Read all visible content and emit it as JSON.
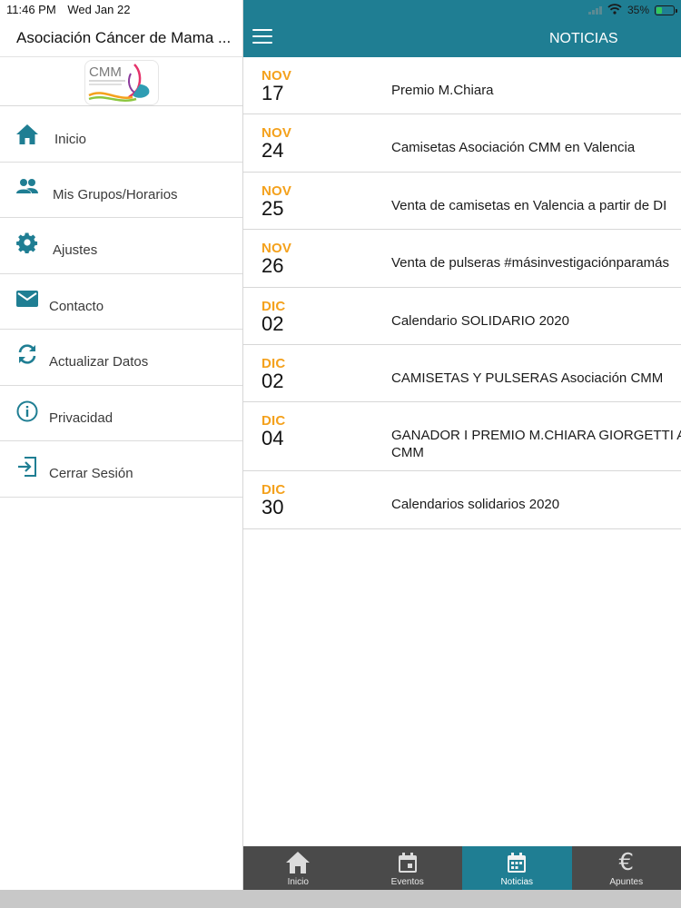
{
  "status_bar": {
    "time": "11:46 PM",
    "date": "Wed Jan 22",
    "battery_text": "35%",
    "battery_level": 0.35
  },
  "sidebar": {
    "app_title": "Asociación Cáncer de Mama ...",
    "logo_text": "CMM",
    "items": [
      {
        "label": "Inicio",
        "icon": "home-icon"
      },
      {
        "label": "Mis Grupos/Horarios",
        "icon": "people-icon"
      },
      {
        "label": "Ajustes",
        "icon": "gear-icon"
      },
      {
        "label": "Contacto",
        "icon": "mail-icon"
      },
      {
        "label": "Actualizar Datos",
        "icon": "refresh-icon"
      },
      {
        "label": "Privacidad",
        "icon": "info-icon"
      },
      {
        "label": "Cerrar Sesión",
        "icon": "logout-icon"
      }
    ]
  },
  "header": {
    "title": "NOTICIAS"
  },
  "news": [
    {
      "month": "NOV",
      "day": "17",
      "title": "Premio M.Chiara"
    },
    {
      "month": "NOV",
      "day": "24",
      "title": "Camisetas Asociación CMM en Valencia"
    },
    {
      "month": "NOV",
      "day": "25",
      "title": "Venta de camisetas en Valencia a partir de DI"
    },
    {
      "month": "NOV",
      "day": "26",
      "title": "Venta de pulseras #másinvestigaciónparamás"
    },
    {
      "month": "DIC",
      "day": "02",
      "title": "Calendario SOLIDARIO 2020"
    },
    {
      "month": "DIC",
      "day": "02",
      "title": "CAMISETAS Y PULSERAS Asociación CMM"
    },
    {
      "month": "DIC",
      "day": "04",
      "title": "GANADOR I PREMIO M.CHIARA GIORGETTI A CMM"
    },
    {
      "month": "DIC",
      "day": "30",
      "title": "Calendarios solidarios 2020"
    }
  ],
  "tabs": [
    {
      "label": "Inicio",
      "icon": "home-icon",
      "active": false
    },
    {
      "label": "Eventos",
      "icon": "calendar-icon",
      "active": false
    },
    {
      "label": "Noticias",
      "icon": "calendar-icon",
      "active": true
    },
    {
      "label": "Apuntes",
      "icon": "euro-icon",
      "active": false
    }
  ],
  "colors": {
    "accent": "#1f7e93",
    "month": "#f4a11c",
    "tabbar": "#4a4a4a"
  }
}
